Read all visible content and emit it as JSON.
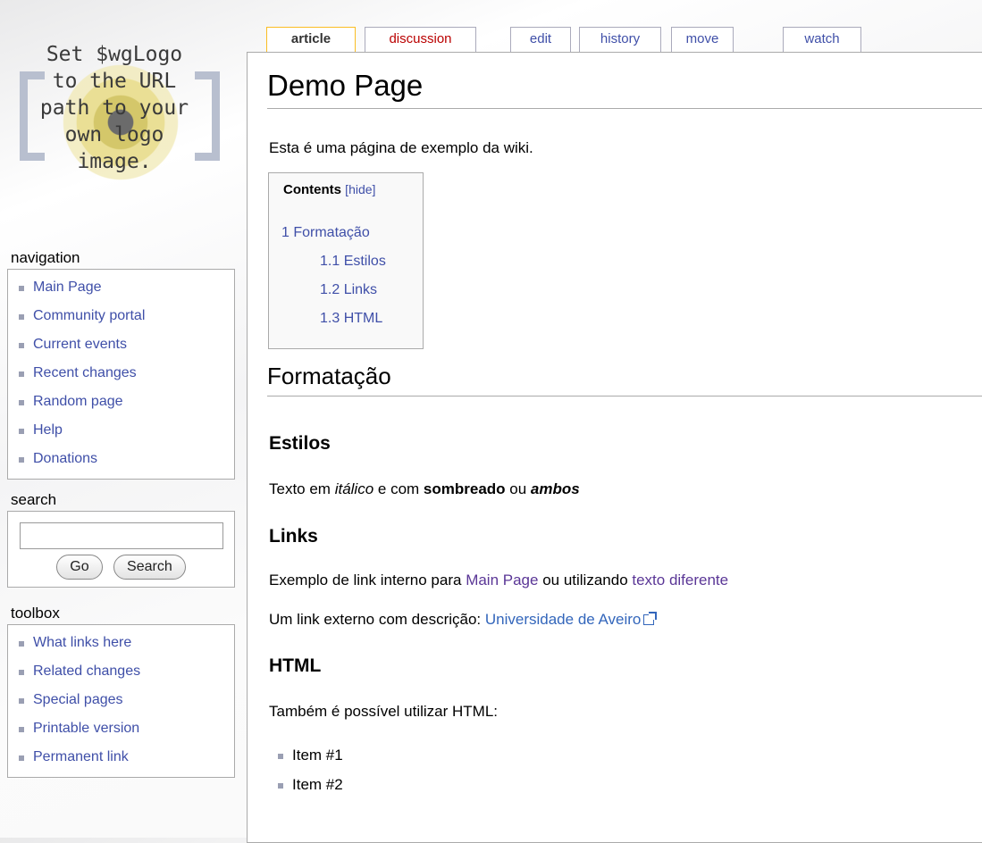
{
  "logo": {
    "text": "Set $wgLogo\nto the URL\npath to your\nown logo\nimage."
  },
  "tabs": [
    {
      "label": "article"
    },
    {
      "label": "discussion"
    },
    {
      "label": "edit"
    },
    {
      "label": "history"
    },
    {
      "label": "move"
    },
    {
      "label": "watch"
    }
  ],
  "navigation": {
    "title": "navigation",
    "items": [
      "Main Page",
      "Community portal",
      "Current events",
      "Recent changes",
      "Random page",
      "Help",
      "Donations"
    ]
  },
  "search": {
    "title": "search",
    "value": "",
    "go_label": "Go",
    "search_label": "Search"
  },
  "toolbox": {
    "title": "toolbox",
    "items": [
      "What links here",
      "Related changes",
      "Special pages",
      "Printable version",
      "Permanent link"
    ]
  },
  "article": {
    "title": "Demo Page",
    "intro": "Esta é uma página de exemplo da wiki.",
    "toc": {
      "title": "Contents",
      "toggle": "hide",
      "entries": [
        "1 Formatação",
        "1.1 Estilos",
        "1.2 Links",
        "1.3 HTML"
      ]
    },
    "h2": "Formatação",
    "estilos": {
      "heading": "Estilos",
      "prefix": "Texto em ",
      "italic": "itálico",
      "mid": " e com ",
      "bold": "sombreado",
      "or": " ou ",
      "both": "ambos"
    },
    "links": {
      "heading": "Links",
      "line1_prefix": "Exemplo de link interno para ",
      "line1_link1": "Main Page",
      "line1_mid": " ou utilizando ",
      "line1_link2": "texto diferente",
      "line2_prefix": "Um link externo com descrição: ",
      "line2_link": "Universidade de Aveiro"
    },
    "html": {
      "heading": "HTML",
      "text": "Também é possível utilizar HTML:",
      "items": [
        "Item #1",
        "Item #2"
      ]
    }
  }
}
